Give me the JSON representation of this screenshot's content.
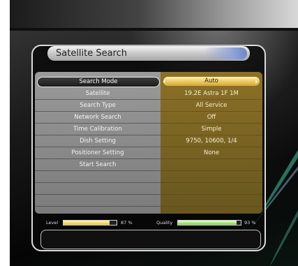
{
  "title": "Satellite Search",
  "menu": [
    {
      "label": "Search Mode",
      "value": "Auto",
      "selected": true
    },
    {
      "label": "Satellite",
      "value": "19.2E Astra 1F 1M",
      "selected": false
    },
    {
      "label": "Search Type",
      "value": "All Service",
      "selected": false
    },
    {
      "label": "Network Search",
      "value": "Off",
      "selected": false
    },
    {
      "label": "Time Calibration",
      "value": "Simple",
      "selected": false
    },
    {
      "label": "Dish Setting",
      "value": "9750, 10600, 1/4",
      "selected": false
    },
    {
      "label": "Positioner Setting",
      "value": "None",
      "selected": false
    },
    {
      "label": "Start Search",
      "value": "",
      "selected": false
    }
  ],
  "level": {
    "label": "Level",
    "percent_text": "87 %",
    "percent": 87
  },
  "quality": {
    "label": "Quality",
    "percent_text": "93 %",
    "percent": 93
  },
  "colors": {
    "accent": "#e8c45a",
    "level_bar": "#e5c23a",
    "quality_bar": "#7ecf42",
    "value_panel": "#967828"
  },
  "icons": {
    "prev": "chevron-left-icon",
    "next": "chevron-right-icon"
  }
}
